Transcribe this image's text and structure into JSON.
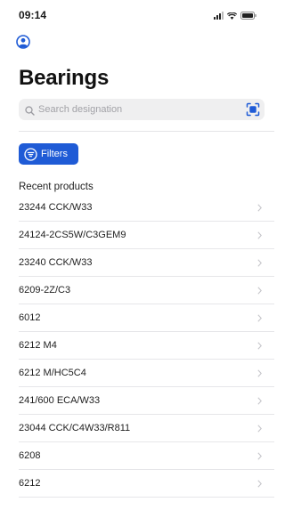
{
  "status_bar": {
    "time": "09:14"
  },
  "header": {
    "title": "Bearings"
  },
  "search": {
    "placeholder": "Search designation"
  },
  "filters": {
    "label": "Filters"
  },
  "recent": {
    "title": "Recent products",
    "items": [
      {
        "label": "23244 CCK/W33"
      },
      {
        "label": "24124-2CS5W/C3GEM9"
      },
      {
        "label": "23240 CCK/W33"
      },
      {
        "label": "6209-2Z/C3"
      },
      {
        "label": "6012"
      },
      {
        "label": "6212 M4"
      },
      {
        "label": "6212 M/HC5C4"
      },
      {
        "label": "241/600 ECA/W33"
      },
      {
        "label": "23044 CCK/C4W33/R811"
      },
      {
        "label": "6208"
      },
      {
        "label": "6212"
      }
    ]
  },
  "colors": {
    "accent": "#1f5bd6",
    "search_bg": "#efeff0"
  }
}
